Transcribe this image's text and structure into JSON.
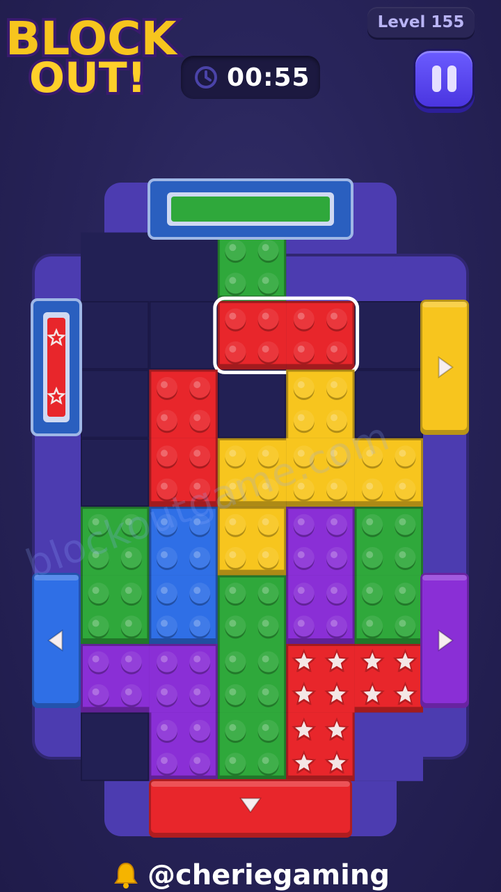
{
  "game": {
    "title_line1": "BLOCK",
    "title_line2": "OUT!",
    "level_label": "Level 155",
    "timer": "00:55",
    "credit": "@cheriegaming",
    "watermark": "blockoutgame.com"
  },
  "colors": {
    "red": "#e8262b",
    "yellow": "#f7c51e",
    "green": "#2fa83b",
    "blue": "#2f6fe6",
    "purple": "#8a2fd6",
    "frame": "#4c3cb0",
    "cell": "#222054"
  },
  "board": {
    "cols": 5,
    "rows": 7,
    "pieces": [
      {
        "id": "green-top",
        "color": "green",
        "cells": [
          [
            2,
            -1
          ]
        ]
      },
      {
        "id": "red-selected",
        "color": "red",
        "selected": true,
        "cells": [
          [
            2,
            0
          ],
          [
            3,
            0
          ]
        ]
      },
      {
        "id": "red-tall",
        "color": "red",
        "cells": [
          [
            1,
            1
          ],
          [
            1,
            2
          ]
        ]
      },
      {
        "id": "yellow-t",
        "color": "yellow",
        "cells": [
          [
            3,
            1
          ],
          [
            2,
            2
          ],
          [
            3,
            2
          ],
          [
            4,
            2
          ]
        ]
      },
      {
        "id": "green-left",
        "color": "green",
        "cells": [
          [
            0,
            3
          ],
          [
            0,
            4
          ]
        ]
      },
      {
        "id": "blue-mid",
        "color": "blue",
        "cells": [
          [
            1,
            3
          ],
          [
            1,
            4
          ]
        ]
      },
      {
        "id": "yellow-small",
        "color": "yellow",
        "cells": [
          [
            2,
            3
          ]
        ]
      },
      {
        "id": "purple-mid",
        "color": "purple",
        "cells": [
          [
            3,
            3
          ],
          [
            3,
            4
          ]
        ]
      },
      {
        "id": "green-right",
        "color": "green",
        "cells": [
          [
            4,
            3
          ],
          [
            4,
            4
          ]
        ]
      },
      {
        "id": "green-long",
        "color": "green",
        "cells": [
          [
            2,
            4
          ],
          [
            2,
            5
          ],
          [
            2,
            6
          ]
        ]
      },
      {
        "id": "purple-l",
        "color": "purple",
        "cells": [
          [
            0,
            5
          ],
          [
            1,
            5
          ],
          [
            1,
            6
          ]
        ]
      },
      {
        "id": "red-star",
        "color": "red",
        "star": true,
        "cells": [
          [
            3,
            5
          ],
          [
            4,
            5
          ],
          [
            3,
            6
          ]
        ]
      }
    ],
    "gates": [
      {
        "id": "gate-top-green",
        "color": "green",
        "side": "top",
        "direction": "up"
      },
      {
        "id": "gate-left-red-star",
        "color": "red",
        "side": "left",
        "direction": "left",
        "star": true
      },
      {
        "id": "gate-right-yellow",
        "color": "yellow",
        "side": "right",
        "direction": "right"
      },
      {
        "id": "gate-left-blue",
        "color": "blue",
        "side": "left",
        "direction": "left"
      },
      {
        "id": "gate-right-purple",
        "color": "purple",
        "side": "right",
        "direction": "right"
      },
      {
        "id": "gate-bottom-red",
        "color": "red",
        "side": "bottom",
        "direction": "down"
      }
    ]
  }
}
